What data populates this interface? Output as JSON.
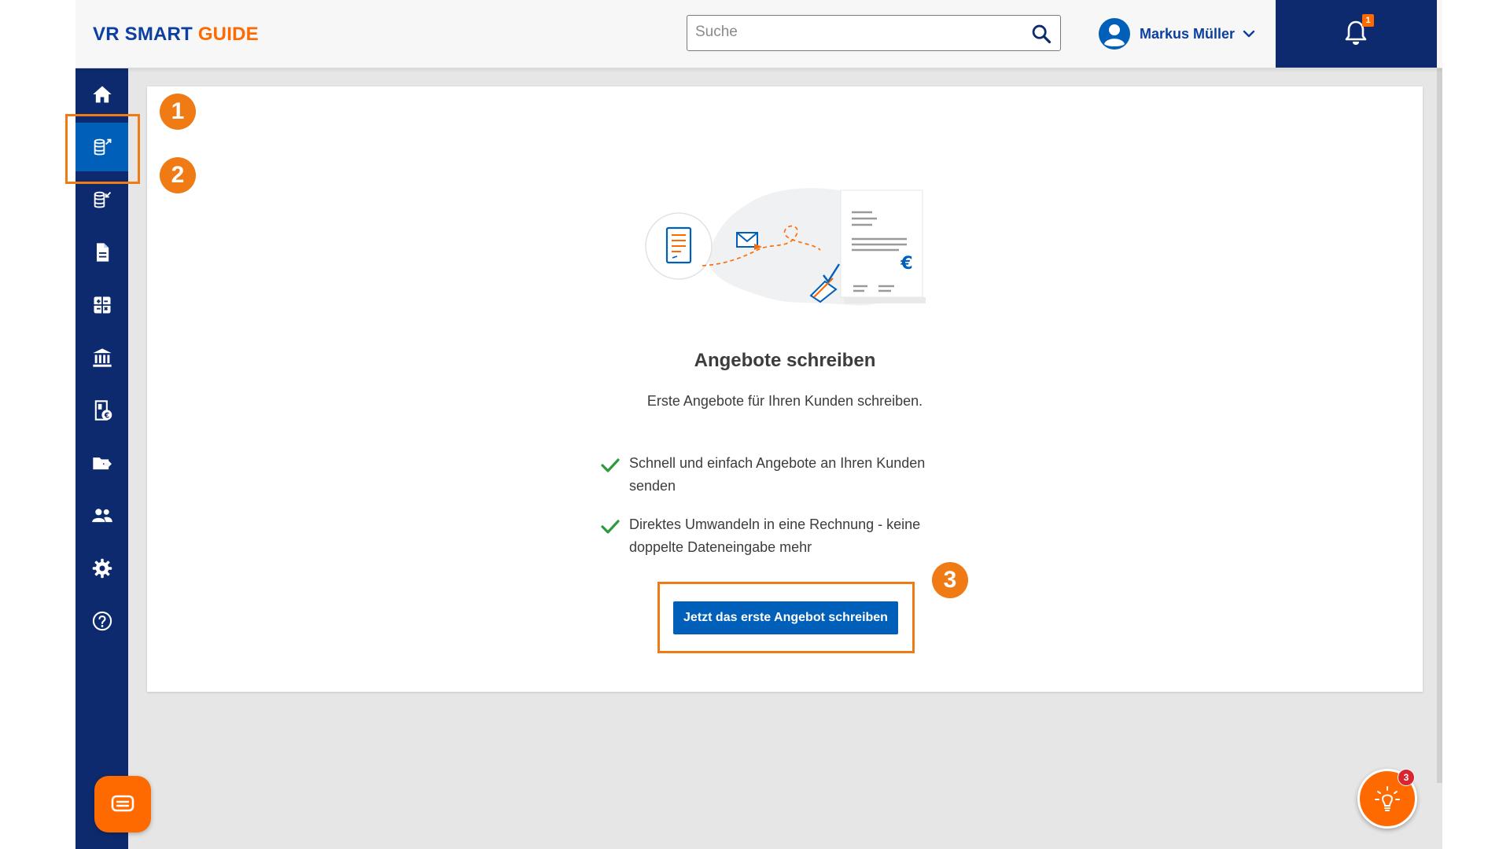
{
  "header": {
    "logo_vr": "VR SMART",
    "logo_guide": "GUIDE",
    "search_placeholder": "Suche",
    "user_name": "Markus Müller",
    "notification_count": "1"
  },
  "sidebar": {
    "items": [
      {
        "icon": "home-icon",
        "active": false
      },
      {
        "icon": "coins-outgoing-icon",
        "active": true
      },
      {
        "icon": "coins-incoming-icon",
        "active": false
      },
      {
        "icon": "document-icon",
        "active": false
      },
      {
        "icon": "calculator-icon",
        "active": false
      },
      {
        "icon": "bank-icon",
        "active": false
      },
      {
        "icon": "receipt-euro-icon",
        "active": false
      },
      {
        "icon": "folder-export-icon",
        "active": false
      },
      {
        "icon": "people-icon",
        "active": false
      },
      {
        "icon": "gear-icon",
        "active": false
      },
      {
        "icon": "help-icon",
        "active": false
      }
    ]
  },
  "main": {
    "title": "Angebote schreiben",
    "subtitle": "Erste Angebote für Ihren Kunden schreiben.",
    "benefits": [
      "Schnell und einfach Angebote an Ihren Kunden senden",
      "Direktes Umwandeln in eine Rechnung - keine doppelte Dateneingabe mehr"
    ],
    "cta_label": "Jetzt das erste Angebot schreiben"
  },
  "annotations": [
    "1",
    "2",
    "3"
  ],
  "tips_count": "3",
  "colors": {
    "navy": "#0d2a6e",
    "blue": "#005fb8",
    "orange": "#ff6a00",
    "annotation": "#f07a14",
    "check": "#2e9a3c"
  }
}
